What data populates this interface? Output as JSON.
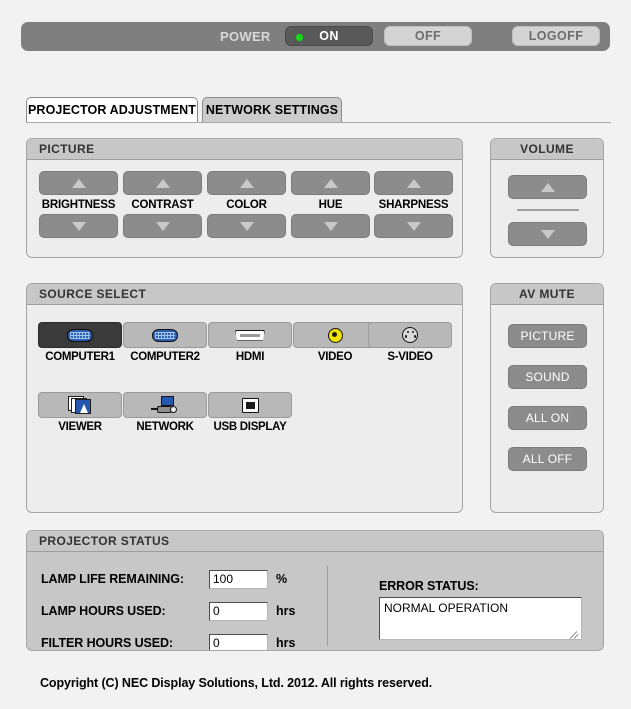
{
  "power_bar": {
    "label": "POWER",
    "on_button": "ON",
    "off_button": "OFF",
    "logoff_button": "LOGOFF",
    "led_color": "#18d818",
    "bar_color": "#7f7f7f",
    "on_state_active": true
  },
  "tabs": [
    {
      "label": "PROJECTOR ADJUSTMENT",
      "active": true
    },
    {
      "label": "NETWORK SETTINGS",
      "active": false
    }
  ],
  "picture": {
    "title": "PICTURE",
    "controls": [
      {
        "label": "BRIGHTNESS"
      },
      {
        "label": "CONTRAST"
      },
      {
        "label": "COLOR"
      },
      {
        "label": "HUE"
      },
      {
        "label": "SHARPNESS"
      }
    ]
  },
  "volume": {
    "title": "VOLUME"
  },
  "source_select": {
    "title": "SOURCE SELECT",
    "items": [
      {
        "label": "COMPUTER1",
        "icon": "vga-connector-icon",
        "selected": true
      },
      {
        "label": "COMPUTER2",
        "icon": "vga-connector-icon",
        "selected": false
      },
      {
        "label": "HDMI",
        "icon": "hdmi-connector-icon",
        "selected": false
      },
      {
        "label": "VIDEO",
        "icon": "rca-composite-icon",
        "selected": false
      },
      {
        "label": "S-VIDEO",
        "icon": "s-video-connector-icon",
        "selected": false
      },
      {
        "label": "VIEWER",
        "icon": "photo-stack-icon",
        "selected": false
      },
      {
        "label": "NETWORK",
        "icon": "network-projector-icon",
        "selected": false
      },
      {
        "label": "USB DISPLAY",
        "icon": "usb-connector-icon",
        "selected": false
      }
    ]
  },
  "av_mute": {
    "title": "AV MUTE",
    "buttons": [
      {
        "label": "PICTURE"
      },
      {
        "label": "SOUND"
      },
      {
        "label": "ALL ON"
      },
      {
        "label": "ALL OFF"
      }
    ]
  },
  "projector_status": {
    "title": "PROJECTOR STATUS",
    "rows": [
      {
        "label": "LAMP LIFE REMAINING:",
        "value": "100",
        "unit": "%"
      },
      {
        "label": "LAMP HOURS USED:",
        "value": "0",
        "unit": "hrs"
      },
      {
        "label": "FILTER HOURS USED:",
        "value": "0",
        "unit": "hrs"
      }
    ],
    "error_status_label": "ERROR STATUS:",
    "error_status_value": "NORMAL OPERATION"
  },
  "footer": {
    "copyright": "Copyright (C) NEC Display Solutions, Ltd. 2012. All rights reserved."
  }
}
